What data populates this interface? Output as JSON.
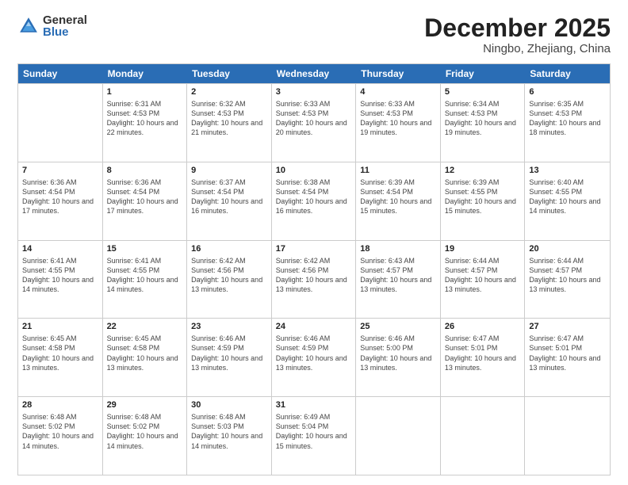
{
  "logo": {
    "general": "General",
    "blue": "Blue"
  },
  "title": {
    "month": "December 2025",
    "location": "Ningbo, Zhejiang, China"
  },
  "weekdays": [
    "Sunday",
    "Monday",
    "Tuesday",
    "Wednesday",
    "Thursday",
    "Friday",
    "Saturday"
  ],
  "weeks": [
    [
      {
        "day": "",
        "sunrise": "",
        "sunset": "",
        "daylight": ""
      },
      {
        "day": "1",
        "sunrise": "Sunrise: 6:31 AM",
        "sunset": "Sunset: 4:53 PM",
        "daylight": "Daylight: 10 hours and 22 minutes."
      },
      {
        "day": "2",
        "sunrise": "Sunrise: 6:32 AM",
        "sunset": "Sunset: 4:53 PM",
        "daylight": "Daylight: 10 hours and 21 minutes."
      },
      {
        "day": "3",
        "sunrise": "Sunrise: 6:33 AM",
        "sunset": "Sunset: 4:53 PM",
        "daylight": "Daylight: 10 hours and 20 minutes."
      },
      {
        "day": "4",
        "sunrise": "Sunrise: 6:33 AM",
        "sunset": "Sunset: 4:53 PM",
        "daylight": "Daylight: 10 hours and 19 minutes."
      },
      {
        "day": "5",
        "sunrise": "Sunrise: 6:34 AM",
        "sunset": "Sunset: 4:53 PM",
        "daylight": "Daylight: 10 hours and 19 minutes."
      },
      {
        "day": "6",
        "sunrise": "Sunrise: 6:35 AM",
        "sunset": "Sunset: 4:53 PM",
        "daylight": "Daylight: 10 hours and 18 minutes."
      }
    ],
    [
      {
        "day": "7",
        "sunrise": "Sunrise: 6:36 AM",
        "sunset": "Sunset: 4:54 PM",
        "daylight": "Daylight: 10 hours and 17 minutes."
      },
      {
        "day": "8",
        "sunrise": "Sunrise: 6:36 AM",
        "sunset": "Sunset: 4:54 PM",
        "daylight": "Daylight: 10 hours and 17 minutes."
      },
      {
        "day": "9",
        "sunrise": "Sunrise: 6:37 AM",
        "sunset": "Sunset: 4:54 PM",
        "daylight": "Daylight: 10 hours and 16 minutes."
      },
      {
        "day": "10",
        "sunrise": "Sunrise: 6:38 AM",
        "sunset": "Sunset: 4:54 PM",
        "daylight": "Daylight: 10 hours and 16 minutes."
      },
      {
        "day": "11",
        "sunrise": "Sunrise: 6:39 AM",
        "sunset": "Sunset: 4:54 PM",
        "daylight": "Daylight: 10 hours and 15 minutes."
      },
      {
        "day": "12",
        "sunrise": "Sunrise: 6:39 AM",
        "sunset": "Sunset: 4:55 PM",
        "daylight": "Daylight: 10 hours and 15 minutes."
      },
      {
        "day": "13",
        "sunrise": "Sunrise: 6:40 AM",
        "sunset": "Sunset: 4:55 PM",
        "daylight": "Daylight: 10 hours and 14 minutes."
      }
    ],
    [
      {
        "day": "14",
        "sunrise": "Sunrise: 6:41 AM",
        "sunset": "Sunset: 4:55 PM",
        "daylight": "Daylight: 10 hours and 14 minutes."
      },
      {
        "day": "15",
        "sunrise": "Sunrise: 6:41 AM",
        "sunset": "Sunset: 4:55 PM",
        "daylight": "Daylight: 10 hours and 14 minutes."
      },
      {
        "day": "16",
        "sunrise": "Sunrise: 6:42 AM",
        "sunset": "Sunset: 4:56 PM",
        "daylight": "Daylight: 10 hours and 13 minutes."
      },
      {
        "day": "17",
        "sunrise": "Sunrise: 6:42 AM",
        "sunset": "Sunset: 4:56 PM",
        "daylight": "Daylight: 10 hours and 13 minutes."
      },
      {
        "day": "18",
        "sunrise": "Sunrise: 6:43 AM",
        "sunset": "Sunset: 4:57 PM",
        "daylight": "Daylight: 10 hours and 13 minutes."
      },
      {
        "day": "19",
        "sunrise": "Sunrise: 6:44 AM",
        "sunset": "Sunset: 4:57 PM",
        "daylight": "Daylight: 10 hours and 13 minutes."
      },
      {
        "day": "20",
        "sunrise": "Sunrise: 6:44 AM",
        "sunset": "Sunset: 4:57 PM",
        "daylight": "Daylight: 10 hours and 13 minutes."
      }
    ],
    [
      {
        "day": "21",
        "sunrise": "Sunrise: 6:45 AM",
        "sunset": "Sunset: 4:58 PM",
        "daylight": "Daylight: 10 hours and 13 minutes."
      },
      {
        "day": "22",
        "sunrise": "Sunrise: 6:45 AM",
        "sunset": "Sunset: 4:58 PM",
        "daylight": "Daylight: 10 hours and 13 minutes."
      },
      {
        "day": "23",
        "sunrise": "Sunrise: 6:46 AM",
        "sunset": "Sunset: 4:59 PM",
        "daylight": "Daylight: 10 hours and 13 minutes."
      },
      {
        "day": "24",
        "sunrise": "Sunrise: 6:46 AM",
        "sunset": "Sunset: 4:59 PM",
        "daylight": "Daylight: 10 hours and 13 minutes."
      },
      {
        "day": "25",
        "sunrise": "Sunrise: 6:46 AM",
        "sunset": "Sunset: 5:00 PM",
        "daylight": "Daylight: 10 hours and 13 minutes."
      },
      {
        "day": "26",
        "sunrise": "Sunrise: 6:47 AM",
        "sunset": "Sunset: 5:01 PM",
        "daylight": "Daylight: 10 hours and 13 minutes."
      },
      {
        "day": "27",
        "sunrise": "Sunrise: 6:47 AM",
        "sunset": "Sunset: 5:01 PM",
        "daylight": "Daylight: 10 hours and 13 minutes."
      }
    ],
    [
      {
        "day": "28",
        "sunrise": "Sunrise: 6:48 AM",
        "sunset": "Sunset: 5:02 PM",
        "daylight": "Daylight: 10 hours and 14 minutes."
      },
      {
        "day": "29",
        "sunrise": "Sunrise: 6:48 AM",
        "sunset": "Sunset: 5:02 PM",
        "daylight": "Daylight: 10 hours and 14 minutes."
      },
      {
        "day": "30",
        "sunrise": "Sunrise: 6:48 AM",
        "sunset": "Sunset: 5:03 PM",
        "daylight": "Daylight: 10 hours and 14 minutes."
      },
      {
        "day": "31",
        "sunrise": "Sunrise: 6:49 AM",
        "sunset": "Sunset: 5:04 PM",
        "daylight": "Daylight: 10 hours and 15 minutes."
      },
      {
        "day": "",
        "sunrise": "",
        "sunset": "",
        "daylight": ""
      },
      {
        "day": "",
        "sunrise": "",
        "sunset": "",
        "daylight": ""
      },
      {
        "day": "",
        "sunrise": "",
        "sunset": "",
        "daylight": ""
      }
    ]
  ]
}
